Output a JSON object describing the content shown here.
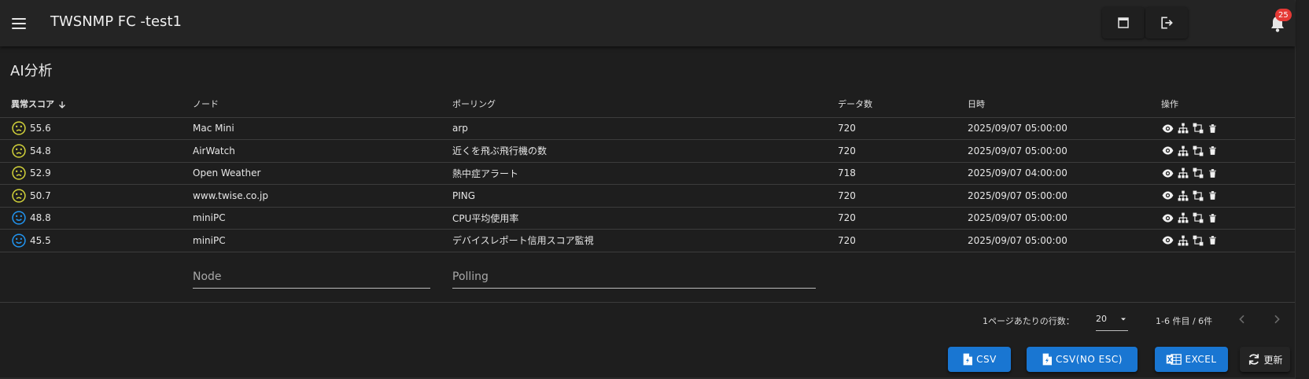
{
  "app": {
    "title": "TWSNMP FC -test1",
    "notifications": "25"
  },
  "page": {
    "title": "AI分析"
  },
  "table": {
    "headers": {
      "score": "異常スコア",
      "node": "ノード",
      "polling": "ポーリング",
      "count": "データ数",
      "time": "日時",
      "ops": "操作"
    },
    "rows": [
      {
        "status": "warn",
        "score": "55.6",
        "node": "Mac Mini",
        "polling": "arp",
        "count": "720",
        "time": "2025/09/07 05:00:00"
      },
      {
        "status": "warn",
        "score": "54.8",
        "node": "AirWatch",
        "polling": "近くを飛ぶ飛行機の数",
        "count": "720",
        "time": "2025/09/07 05:00:00"
      },
      {
        "status": "warn",
        "score": "52.9",
        "node": "Open Weather",
        "polling": "熱中症アラート",
        "count": "718",
        "time": "2025/09/07 04:00:00"
      },
      {
        "status": "warn",
        "score": "50.7",
        "node": "www.twise.co.jp",
        "polling": "PING",
        "count": "720",
        "time": "2025/09/07 05:00:00"
      },
      {
        "status": "ok",
        "score": "48.8",
        "node": "miniPC",
        "polling": "CPU平均使用率",
        "count": "720",
        "time": "2025/09/07 05:00:00"
      },
      {
        "status": "ok",
        "score": "45.5",
        "node": "miniPC",
        "polling": "デバイスレポート信用スコア監視",
        "count": "720",
        "time": "2025/09/07 05:00:00"
      }
    ],
    "filters": {
      "node_placeholder": "Node",
      "polling_placeholder": "Polling"
    }
  },
  "pagination": {
    "rows_per_page_label": "1ページあたりの行数：",
    "rows_per_page": "20",
    "range_text": "1-6 件目 / 6件"
  },
  "actions": {
    "csv": "CSV",
    "csv_no_esc": "CSV(NO ESC)",
    "excel": "EXCEL",
    "refresh": "更新"
  },
  "colors": {
    "warn_face": "#d4d43a",
    "ok_face": "#2196f3",
    "primary": "#1976d2",
    "badge": "#e53935"
  }
}
